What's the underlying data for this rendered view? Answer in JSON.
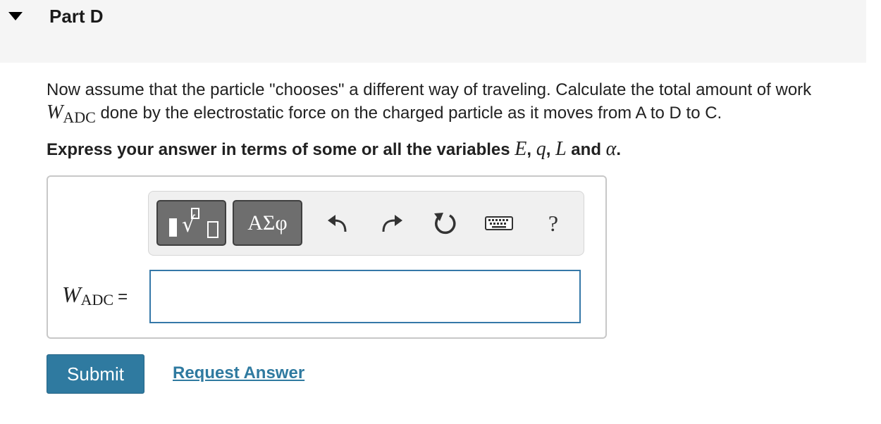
{
  "part": {
    "title": "Part D"
  },
  "question": {
    "text_before": "Now assume that the particle \"chooses\" a different way of traveling. Calculate the total amount of work ",
    "symbol": "W",
    "subscript": "ADC",
    "text_after": " done by the electrostatic force on the charged particle as it moves from A to D to C."
  },
  "instructions": {
    "prefix": "Express your answer in terms of some or all the variables ",
    "var1": "E",
    "sep1": ", ",
    "var2": "q",
    "sep2": ", ",
    "var3": "L",
    "and": " and ",
    "var4": "α",
    "end": "."
  },
  "toolbar": {
    "symbols_label": "ΑΣφ",
    "help_label": "?"
  },
  "answer": {
    "label_symbol": "W",
    "label_subscript": "ADC",
    "equals": "=",
    "value": ""
  },
  "actions": {
    "submit_label": "Submit",
    "request_label": "Request Answer"
  },
  "colors": {
    "accent": "#2f7aa0",
    "input_border": "#3578a8",
    "header_bg": "#f5f5f5"
  }
}
